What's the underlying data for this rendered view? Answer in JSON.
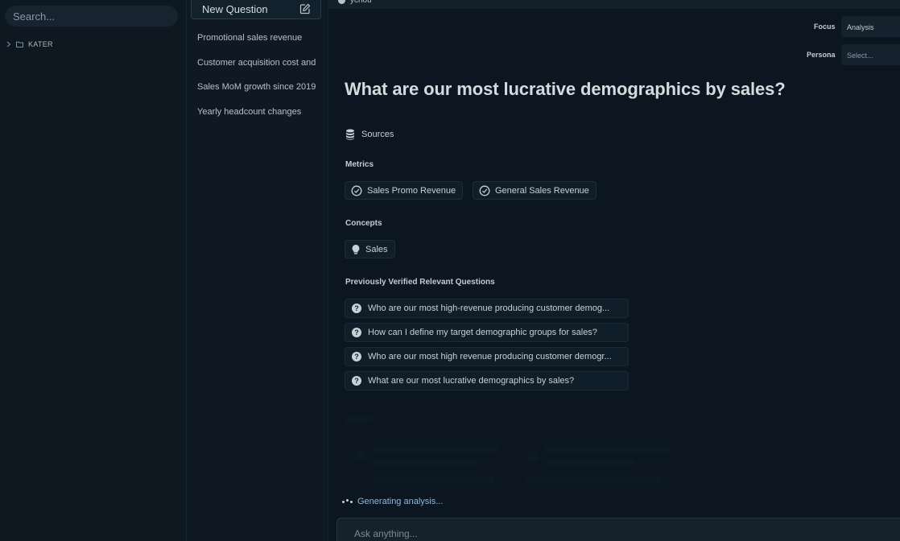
{
  "sidebar": {
    "search_placeholder": "Search...",
    "tree": [
      {
        "label": "KATER"
      }
    ]
  },
  "history": {
    "new_question_label": "New Question",
    "items": [
      {
        "label": "Promotional sales revenue"
      },
      {
        "label": "Customer acquisition cost and"
      },
      {
        "label": "Sales MoM growth since 2019"
      },
      {
        "label": "Yearly headcount changes"
      }
    ]
  },
  "header": {
    "user_name": "ychou",
    "focus_label": "Focus",
    "focus_value": "Analysis",
    "persona_label": "Persona",
    "persona_placeholder": "Select..."
  },
  "main": {
    "question": "What are our most lucrative demographics by sales?",
    "sources_label": "Sources",
    "metrics_label": "Metrics",
    "metrics": [
      {
        "label": "Sales Promo Revenue"
      },
      {
        "label": "General Sales Revenue"
      }
    ],
    "concepts_label": "Concepts",
    "concepts": [
      {
        "label": "Sales"
      }
    ],
    "prev_questions_label": "Previously Verified Relevant Questions",
    "prev_questions": [
      {
        "label": "Who are our most high-revenue producing customer demog..."
      },
      {
        "label": "How can I define my target demographic groups for sales?"
      },
      {
        "label": "Who are our most high revenue producing customer demogr..."
      },
      {
        "label": "What are our most lucrative demographics by sales?"
      }
    ],
    "status": "Generating analysis...",
    "ask_placeholder": "Ask anything..."
  },
  "colors": {
    "background": "#0b1620",
    "panel": "#101e29",
    "accent_link": "#8fb7de"
  }
}
